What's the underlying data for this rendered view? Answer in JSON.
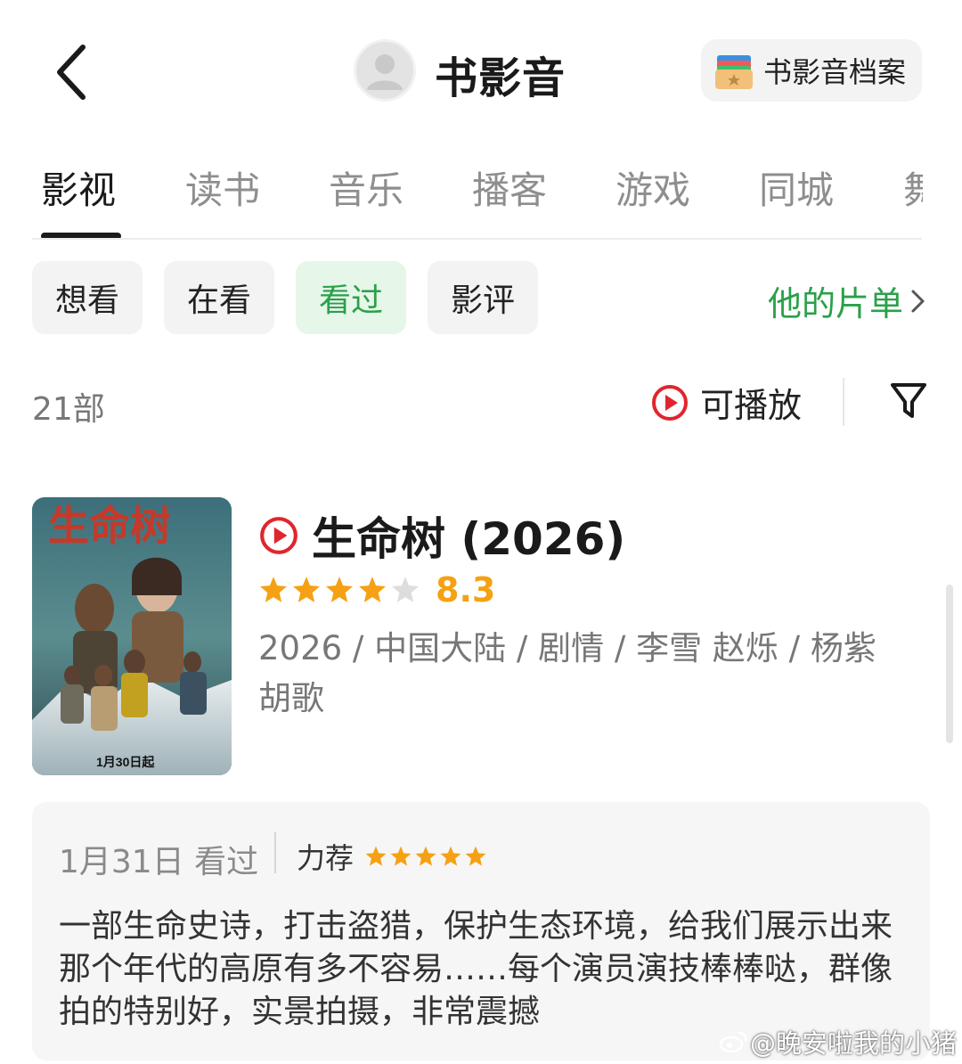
{
  "header": {
    "title": "书影音",
    "archive_label": "书影音档案"
  },
  "tabs": [
    {
      "label": "影视",
      "active": true
    },
    {
      "label": "读书"
    },
    {
      "label": "音乐"
    },
    {
      "label": "播客"
    },
    {
      "label": "游戏"
    },
    {
      "label": "同城"
    },
    {
      "label": "舞"
    }
  ],
  "filters": [
    {
      "label": "想看"
    },
    {
      "label": "在看"
    },
    {
      "label": "看过",
      "active": true
    },
    {
      "label": "影评"
    }
  ],
  "list_link": "他的片单",
  "count": "21部",
  "playable_label": "可播放",
  "movie": {
    "title": "生命树 (2026)",
    "rating": 4,
    "rating_max": 5,
    "rating_value": "8.3",
    "meta": "2026 / 中国大陆 / 剧情 / 李雪 赵烁 / 杨紫 胡歌",
    "poster_title": "生命树",
    "poster_date": "1月30日起"
  },
  "review": {
    "date": "1月31日 看过",
    "recommend_label": "力荐",
    "stars": 5,
    "text": "一部生命史诗，打击盗猎，保护生态环境，给我们展示出来那个年代的高原有多不容易……每个演员演技棒棒哒，群像拍的特别好，实景拍摄，非常震撼"
  },
  "watermark": "@晚安啦我的小猪",
  "colors": {
    "accent_green": "#2aa04a",
    "chip_active_bg": "#e6f6e9",
    "star": "#f5a113",
    "play_red": "#e0262d"
  },
  "icons": [
    "back-icon",
    "avatar-icon",
    "archive-icon",
    "play-circle-icon",
    "filter-icon",
    "chevron-right-icon",
    "star-icon",
    "weibo-icon"
  ]
}
